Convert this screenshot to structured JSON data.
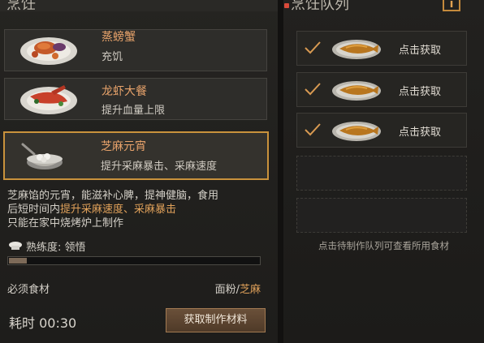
{
  "header": {
    "left_title": "烹饪",
    "right_title": "烹饪队列",
    "info_icon": "i"
  },
  "recipes": [
    {
      "name": "蒸螃蟹",
      "desc": "充饥",
      "icon": "crab-dish-icon"
    },
    {
      "name": "龙虾大餐",
      "desc": "提升血量上限",
      "icon": "lobster-dish-icon"
    },
    {
      "name": "芝麻元宵",
      "desc": "提升采麻暴击、采麻速度",
      "icon": "yuanxiao-dish-icon",
      "selected": true
    }
  ],
  "detail": {
    "desc_line1": "芝麻馅的元宵，能滋补心脾，提神健脑，食用",
    "desc_line2_a": "后短时间内",
    "desc_line2_b": "提升采麻速度、采麻暴击",
    "desc_line3": "只能在家中烧烤炉上制作",
    "proficiency_label": "熟练度: 领悟",
    "proficiency_progress": 0.07,
    "materials_label": "必须食材",
    "material_a": "面粉",
    "material_sep": "/",
    "material_b": "芝麻",
    "time_label": "耗时 00:30",
    "get_materials_button": "获取制作材料"
  },
  "queue": {
    "slots": [
      {
        "status": "done",
        "label": "点击获取",
        "icon": "fish-dish-icon"
      },
      {
        "status": "done",
        "label": "点击获取",
        "icon": "fish-dish-icon"
      },
      {
        "status": "done",
        "label": "点击获取",
        "icon": "fish-dish-icon"
      },
      {
        "status": "empty"
      },
      {
        "status": "empty"
      }
    ],
    "hint": "点击待制作队列可查看所用食材"
  },
  "colors": {
    "accent": "#c9923c",
    "highlight_text": "#e0a15a",
    "check": "#d89a52"
  }
}
